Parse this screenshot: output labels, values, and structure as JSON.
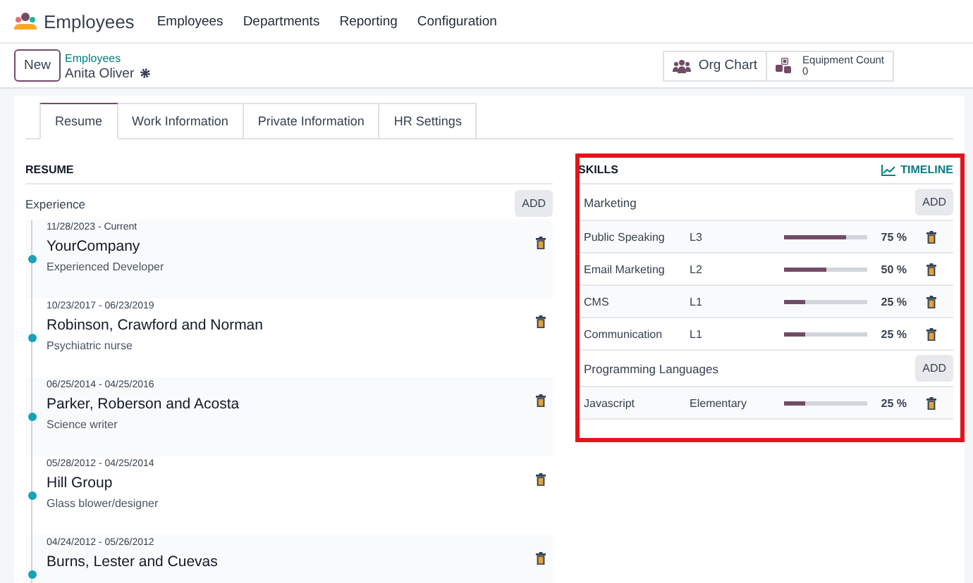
{
  "navbar": {
    "app_name": "Employees",
    "menu": [
      "Employees",
      "Departments",
      "Reporting",
      "Configuration"
    ]
  },
  "control_panel": {
    "new_button": "New",
    "breadcrumb": "Employees",
    "record_name": "Anita Oliver",
    "smart_buttons": [
      {
        "kind": "org",
        "label": "Org Chart"
      },
      {
        "kind": "equipment",
        "label": "Equipment Count",
        "count": "0"
      }
    ]
  },
  "tabs": [
    {
      "label": "Resume",
      "selected": true
    },
    {
      "label": "Work Information",
      "selected": false
    },
    {
      "label": "Private Information",
      "selected": false
    },
    {
      "label": "HR Settings",
      "selected": false
    }
  ],
  "resume": {
    "title": "RESUME",
    "section": "Experience",
    "add_button": "ADD",
    "items": [
      {
        "dates": "11/28/2023 - Current",
        "company": "YourCompany",
        "role": "Experienced Developer"
      },
      {
        "dates": "10/23/2017 - 06/23/2019",
        "company": "Robinson, Crawford and Norman",
        "role": "Psychiatric nurse"
      },
      {
        "dates": "06/25/2014 - 04/25/2016",
        "company": "Parker, Roberson and Acosta",
        "role": "Science writer"
      },
      {
        "dates": "05/28/2012 - 04/25/2014",
        "company": "Hill Group",
        "role": "Glass blower/designer"
      },
      {
        "dates": "04/24/2012 - 05/26/2012",
        "company": "Burns, Lester and Cuevas"
      }
    ]
  },
  "skills": {
    "title": "SKILLS",
    "timeline_button": "TIMELINE",
    "groups": [
      {
        "name": "Marketing",
        "add_button": "ADD",
        "skills": [
          {
            "name": "Public Speaking",
            "level_name": "L3",
            "level": 0.75,
            "percent": "75 %"
          },
          {
            "name": "Email Marketing",
            "level_name": "L2",
            "level": 0.5,
            "percent": "50 %"
          },
          {
            "name": "CMS",
            "level_name": "L1",
            "level": 0.25,
            "percent": "25 %"
          },
          {
            "name": "Communication",
            "level_name": "L1",
            "level": 0.25,
            "percent": "25 %"
          }
        ]
      },
      {
        "name": "Programming Languages",
        "add_button": "ADD",
        "skills": [
          {
            "name": "Javascript",
            "level_name": "Elementary",
            "level": 0.25,
            "percent": "25 %"
          }
        ]
      }
    ]
  }
}
